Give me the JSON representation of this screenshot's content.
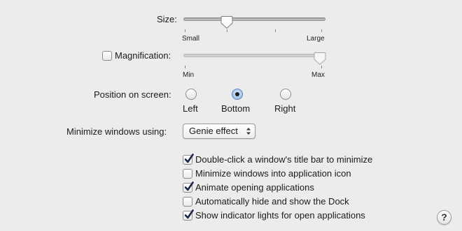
{
  "size": {
    "label": "Size:",
    "min_label": "Small",
    "max_label": "Large",
    "value_fraction": 0.31
  },
  "magnification": {
    "label": "Magnification:",
    "checked": false,
    "min_label": "Min",
    "max_label": "Max",
    "value_fraction": 1.0
  },
  "position": {
    "label": "Position on screen:",
    "options": [
      "Left",
      "Bottom",
      "Right"
    ],
    "selected": "Bottom"
  },
  "minimize": {
    "label": "Minimize windows using:",
    "value": "Genie effect"
  },
  "options": [
    {
      "label": "Double-click a window's title bar to minimize",
      "checked": true
    },
    {
      "label": "Minimize windows into application icon",
      "checked": false
    },
    {
      "label": "Animate opening applications",
      "checked": true
    },
    {
      "label": "Automatically hide and show the Dock",
      "checked": false
    },
    {
      "label": "Show indicator lights for open applications",
      "checked": true
    }
  ],
  "help": {
    "label": "?"
  },
  "colors": {
    "background": "#ececec",
    "checkmark": "#1a2a44",
    "radio_selected": "#a9c8ef"
  },
  "icons": {
    "checkmark": "checkmark-icon",
    "popup_arrows": "chevron-up-down-icon",
    "slider_thumb": "slider-thumb-icon"
  }
}
